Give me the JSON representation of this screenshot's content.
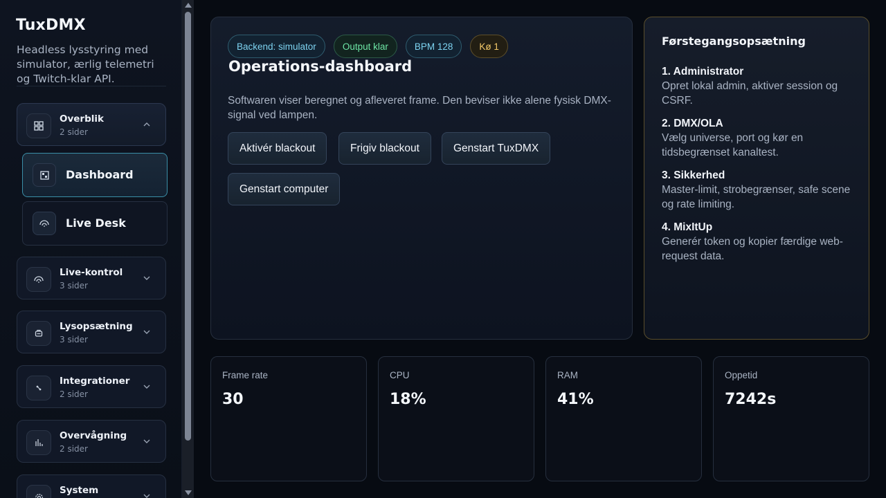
{
  "brand": {
    "title": "TuxDMX",
    "description": "Headless lysstyring med simulator, ærlig telemetri og Twitch-klar API."
  },
  "sidebar": {
    "groups": [
      {
        "title": "Overblik",
        "subtitle": "2 sider",
        "icon": "grid-icon",
        "expanded": true,
        "items": [
          {
            "label": "Dashboard",
            "icon": "dashboard-icon",
            "active": true
          },
          {
            "label": "Live Desk",
            "icon": "signal-icon",
            "active": false
          }
        ]
      },
      {
        "title": "Live-kontrol",
        "subtitle": "3 sider",
        "icon": "signal-icon",
        "expanded": false
      },
      {
        "title": "Lysopsætning",
        "subtitle": "3 sider",
        "icon": "lamp-icon",
        "expanded": false
      },
      {
        "title": "Integrationer",
        "subtitle": "2 sider",
        "icon": "plug-icon",
        "expanded": false
      },
      {
        "title": "Overvågning",
        "subtitle": "2 sider",
        "icon": "bars-icon",
        "expanded": false
      },
      {
        "title": "System",
        "subtitle": "",
        "icon": "gear-icon",
        "expanded": false
      }
    ]
  },
  "main": {
    "badges": [
      "Backend: simulator",
      "Output klar",
      "BPM 128",
      "Kø 1"
    ],
    "title": "Operations-dashboard",
    "description": "Softwaren viser beregnet og afleveret frame. Den beviser ikke alene fysisk DMX-signal ved lampen.",
    "buttons": [
      "Aktivér blackout",
      "Frigiv blackout",
      "Genstart TuxDMX",
      "Genstart computer"
    ]
  },
  "setup": {
    "title": "Førstegangsopsætning",
    "steps": [
      {
        "title": "1. Administrator",
        "desc": "Opret lokal admin, aktiver session og CSRF."
      },
      {
        "title": "2. DMX/OLA",
        "desc": "Vælg universe, port og kør en tidsbegrænset kanaltest."
      },
      {
        "title": "3. Sikkerhed",
        "desc": "Master-limit, strobegrænser, safe scene og rate limiting."
      },
      {
        "title": "4. MixItUp",
        "desc": "Generér token og kopier færdige web-request data."
      }
    ]
  },
  "stats": [
    {
      "label": "Frame rate",
      "value": "30"
    },
    {
      "label": "CPU",
      "value": "18%"
    },
    {
      "label": "RAM",
      "value": "41%"
    },
    {
      "label": "Oppetid",
      "value": "7242s"
    }
  ],
  "colors": {
    "accent_cyan": "#7dd3f0",
    "accent_green": "#6ee7a6",
    "accent_amber": "#f3c969",
    "active_border": "#3a8fa8",
    "setup_border": "#5a4e2c"
  }
}
